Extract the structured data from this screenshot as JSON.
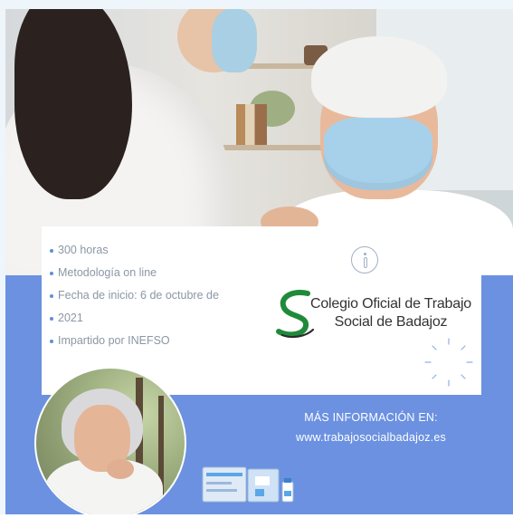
{
  "info_panel": {
    "bullets": [
      "300 horas",
      "Metodología on line",
      "Fecha de inicio: 6 de octubre de",
      "2021",
      "Impartido por INEFSO"
    ]
  },
  "logo": {
    "line1": "Colegio Oficial de Trabajo",
    "line2": "Social de Badajoz"
  },
  "contact": {
    "heading": "MÁS INFORMACIÓN EN:",
    "url": "www.trabajosocialbadajoz.es"
  },
  "icons": {
    "info": "info-icon",
    "logo_mark": "s-logo-icon",
    "decor": "dots-ring-icon",
    "card": "card-illustration-icon"
  },
  "colors": {
    "blue_band": "#6b91e0",
    "bullet_text": "#8b97a4",
    "logo_green": "#1f8b3a"
  }
}
